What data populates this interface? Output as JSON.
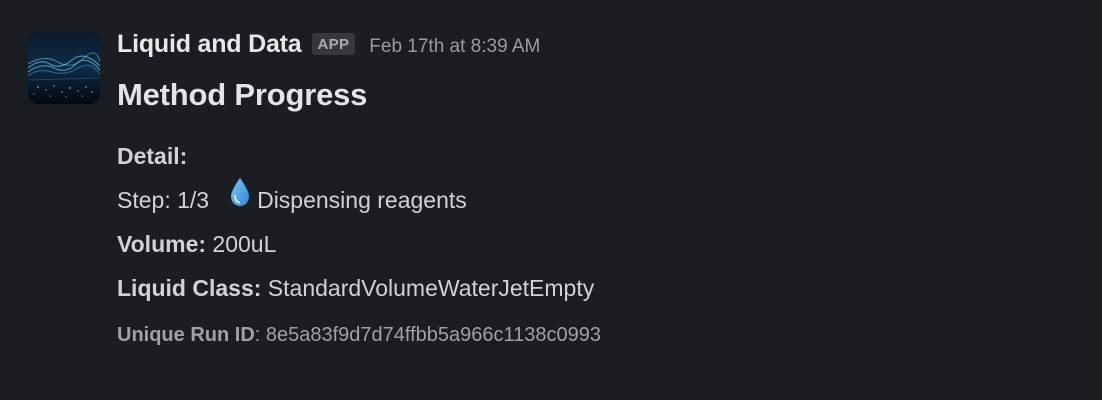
{
  "message": {
    "sender": "Liquid and Data",
    "badge": "APP",
    "timestamp": "Feb 17th at 8:39 AM",
    "title": "Method Progress",
    "detail_label": "Detail:",
    "step_prefix": "Step: 1/3",
    "step_icon": "droplet-icon",
    "step_text": "Dispensing reagents",
    "volume_label": "Volume:",
    "volume_value": "200uL",
    "liquid_class_label": "Liquid Class:",
    "liquid_class_value": "StandardVolumeWaterJetEmpty",
    "run_id_label": "Unique Run ID",
    "run_id_sep": ":",
    "run_id_value": "8e5a83f9d7d74ffbb5a966c1138c0993"
  },
  "colors": {
    "background": "#1a1d21",
    "text": "#d1d2d3",
    "muted": "#9a9b9d",
    "drop": "#4aa3e8"
  }
}
